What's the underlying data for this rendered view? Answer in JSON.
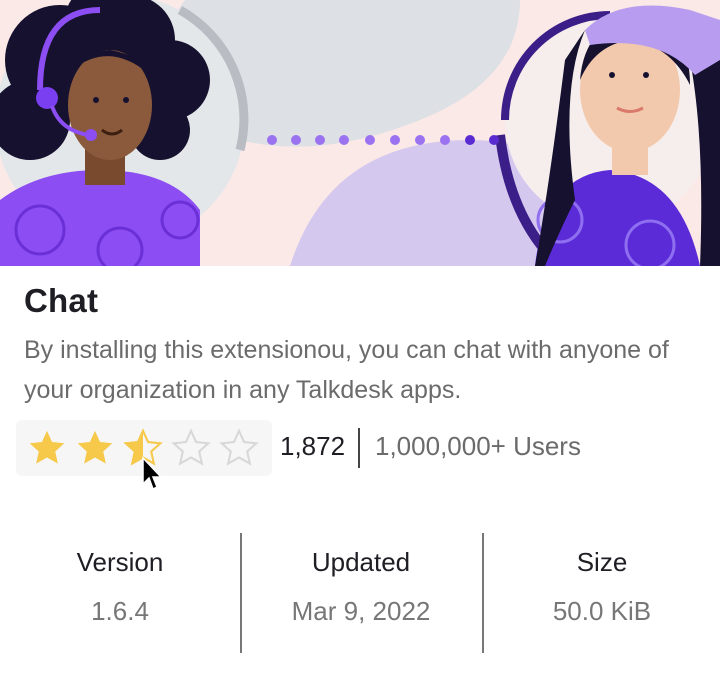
{
  "app": {
    "title": "Chat",
    "description": "By installing this extensionou, you can chat with anyone of your organization in any Talkdesk apps."
  },
  "rating": {
    "value": 2.5,
    "max": 5,
    "count": "1,872",
    "users": "1,000,000+ Users",
    "stars": [
      {
        "icon": "star-filled-icon"
      },
      {
        "icon": "star-filled-icon"
      },
      {
        "icon": "star-half-icon"
      },
      {
        "icon": "star-empty-icon"
      },
      {
        "icon": "star-empty-icon"
      }
    ],
    "colors": {
      "filled": "#f6c94a",
      "empty": "#d8d8d8"
    }
  },
  "stats": [
    {
      "label": "Version",
      "value": "1.6.4"
    },
    {
      "label": "Updated",
      "value": "Mar 9, 2022"
    },
    {
      "label": "Size",
      "value": "50.0 KiB"
    }
  ],
  "hero": {
    "illustration": "support-agent-chatting-with-user",
    "colors": {
      "purple": "#7a3ff0",
      "dark_purple": "#3b1e87",
      "lavender": "#d5c8ef",
      "bg_pink": "#fbe9e7",
      "bg_gray": "#dde0e4"
    }
  }
}
